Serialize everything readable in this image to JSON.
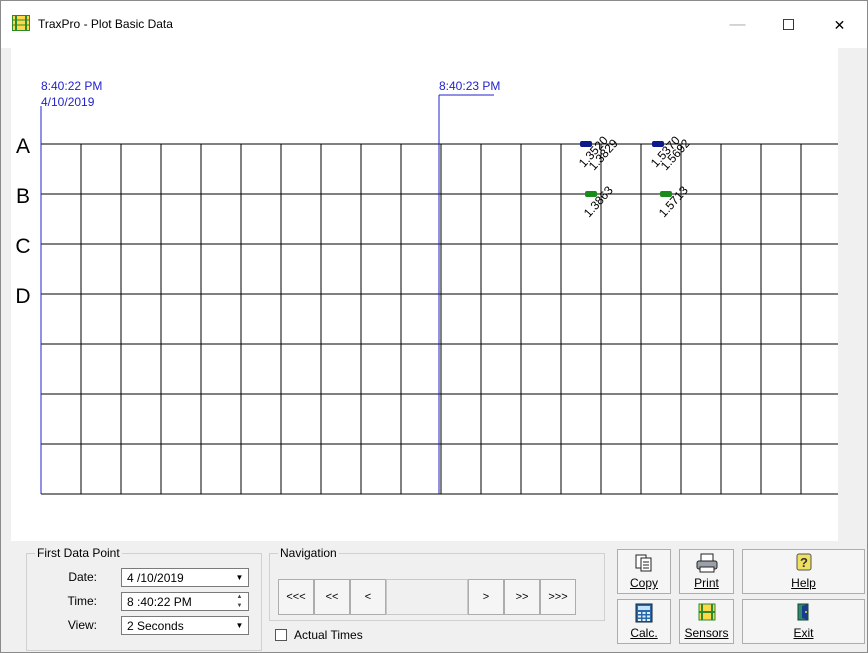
{
  "window": {
    "title": "TraxPro - Plot Basic Data",
    "controls": {
      "minimize": "—",
      "maximize": "☐",
      "close": "✕"
    }
  },
  "plot": {
    "cursors": [
      {
        "time": "8:40:22 PM",
        "date": "4/10/2019"
      },
      {
        "time": "8:40:23 PM",
        "date": ""
      }
    ],
    "rows": [
      "A",
      "B",
      "C",
      "D"
    ],
    "readings": [
      {
        "row": "A",
        "values": [
          "1.3520",
          "1.3829"
        ],
        "color": "#0a1a8c"
      },
      {
        "row": "A",
        "values": [
          "1.5370",
          "1.5692"
        ],
        "color": "#0a1a8c"
      },
      {
        "row": "B",
        "values": [
          "1.3863"
        ],
        "color": "#1a8a1a"
      },
      {
        "row": "B",
        "values": [
          "1.5713"
        ],
        "color": "#1a8a1a"
      }
    ],
    "colors": {
      "cursor": "#2222cc",
      "grid": "#000000"
    }
  },
  "first_data_point": {
    "title": "First Data Point",
    "date_label": "Date:",
    "date_value": "4 /10/2019",
    "time_label": "Time:",
    "time_value": "8 :40:22 PM",
    "view_label": "View:",
    "view_value": "2 Seconds"
  },
  "navigation": {
    "title": "Navigation",
    "buttons": [
      "<<<",
      "<<",
      "<",
      ">",
      ">>",
      ">>>"
    ],
    "actual_times_label": "Actual Times",
    "actual_times_checked": false
  },
  "toolbar": {
    "copy_label": "Copy",
    "print_label": "Print",
    "help_label": "Help",
    "calc_label": "Calc.",
    "sensors_label": "Sensors",
    "exit_label": "Exit"
  }
}
